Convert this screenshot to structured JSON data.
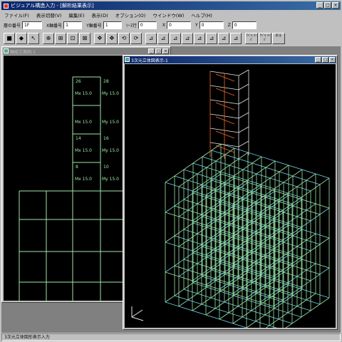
{
  "app": {
    "title": "ビジュアル構造入力 - [解析結果表示]",
    "window_buttons": [
      "_",
      "□",
      "×"
    ]
  },
  "menu": [
    "ファイル(F)",
    "表示切替(V)",
    "編集(E)",
    "表示(D)",
    "オプション(O)",
    "ウインドウ(W)",
    "ヘルプ(H)"
  ],
  "fields": {
    "story_label": "層の番号",
    "story_value": "1F",
    "frame_x_label": "X軸番号",
    "frame_x_value": "1",
    "frame_y_label": "Y軸番号",
    "frame_y_value": "1",
    "coord_label": "ｿｰｽ行",
    "coord_x_label": "X",
    "coord_x_value": "0",
    "coord_y_label": "Y",
    "coord_y_value": "0",
    "coord_z_label": "Z",
    "coord_z_value": "0"
  },
  "toolbar": {
    "buttons": [
      "■",
      "◆",
      "↖",
      "⊕",
      "⊞",
      "⊡",
      "⊠",
      "✥",
      "✥",
      "⟲",
      "⟳",
      "⊿",
      "⊿",
      "⊿",
      "⊿",
      "⊿",
      "⊿",
      "⊿",
      "⊿"
    ],
    "text_buttons": [
      "ﾗﾍﾞﾙ ﾒﾝﾊﾞ",
      "ﾗﾍﾞﾙ ﾒﾝﾊﾞ",
      "戻る"
    ]
  },
  "child_left": {
    "title": "軸組立面図-1",
    "labels": {
      "mx1": "Mx 15.0",
      "my1": "My 15.0",
      "mx2": "Mx 15.0",
      "my2": "My 15.0",
      "mx3": "Mx 15.0",
      "my3": "My 15.0",
      "mx4": "Mx 15.0",
      "my4": "My 15.0",
      "n26": "26",
      "n28": "28",
      "n14": "14",
      "n16": "16",
      "n8": "8",
      "n10": "10"
    }
  },
  "child_right": {
    "title": "3次元立体図表示-1"
  },
  "status": {
    "text": "3次元立体図形表示入力"
  },
  "colors": {
    "grid_green": "#9fe8a8",
    "grid_cyan": "#6fd6e6",
    "tower_orange": "#f06a2a",
    "tower_white": "#e8e8e8"
  }
}
